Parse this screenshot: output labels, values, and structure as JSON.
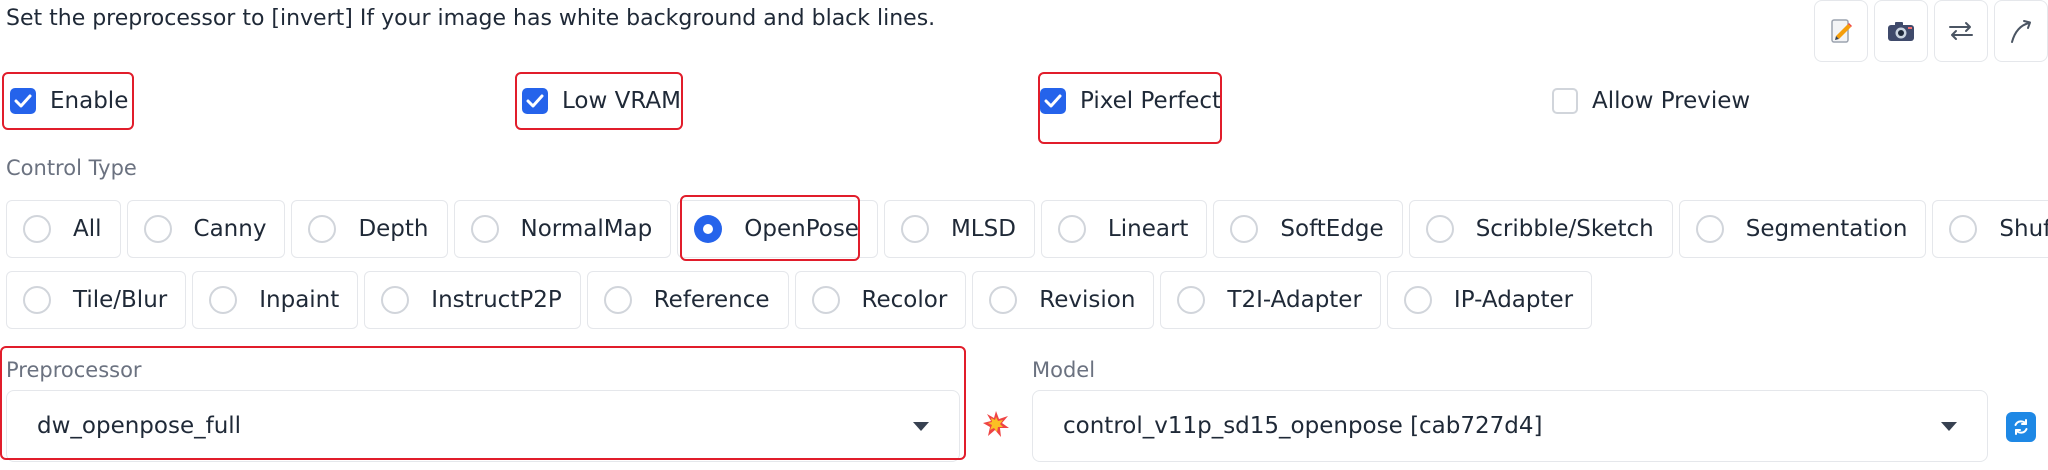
{
  "hint": "Set the preprocessor to [invert] If your image has white background and black lines.",
  "toolbar": {
    "icons": [
      "edit-icon",
      "camera-icon",
      "swap-icon",
      "curve-arrow-icon"
    ]
  },
  "checkboxes": {
    "enable": {
      "label": "Enable",
      "checked": true
    },
    "low_vram": {
      "label": "Low VRAM",
      "checked": true
    },
    "pixel_perfect": {
      "label": "Pixel Perfect",
      "checked": true
    },
    "allow_preview": {
      "label": "Allow Preview",
      "checked": false
    }
  },
  "control_type": {
    "label": "Control Type",
    "selected": "OpenPose",
    "row1": [
      "All",
      "Canny",
      "Depth",
      "NormalMap",
      "OpenPose",
      "MLSD",
      "Lineart",
      "SoftEdge",
      "Scribble/Sketch",
      "Segmentation",
      "Shuffle"
    ],
    "row2": [
      "Tile/Blur",
      "Inpaint",
      "InstructP2P",
      "Reference",
      "Recolor",
      "Revision",
      "T2I-Adapter",
      "IP-Adapter"
    ]
  },
  "preprocessor": {
    "label": "Preprocessor",
    "value": "dw_openpose_full"
  },
  "model": {
    "label": "Model",
    "value": "control_v11p_sd15_openpose [cab727d4]"
  },
  "colors": {
    "accent": "#2563eb",
    "highlight": "#e11d2b",
    "refresh": "#1e88e5"
  }
}
